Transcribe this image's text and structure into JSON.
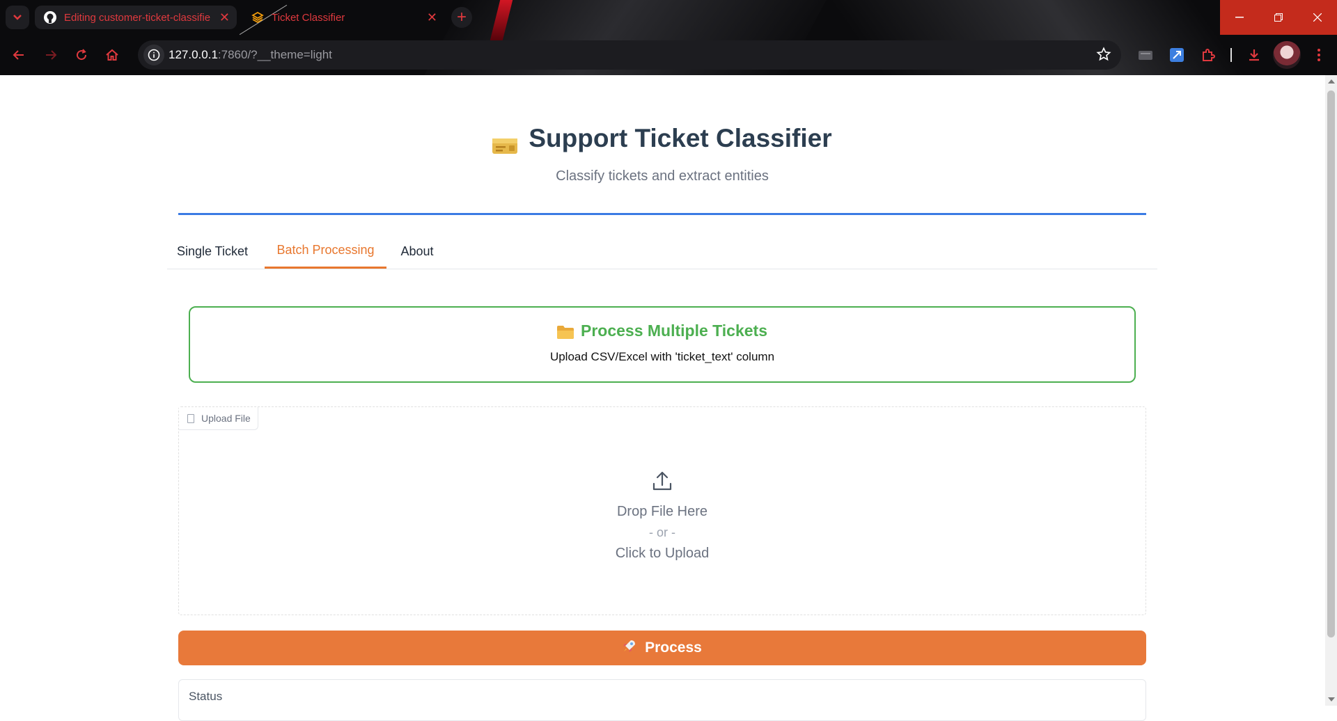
{
  "browser": {
    "tabs": [
      {
        "title": "Editing customer-ticket-classifier",
        "icon": "github-icon"
      },
      {
        "title": "Ticket Classifier",
        "icon": "gradio-icon"
      }
    ],
    "new_tab_symbol": "+",
    "close_symbol": "✕",
    "address": {
      "host": "127.0.0.1",
      "rest": ":7860/?__theme=light"
    },
    "accent_color": "#e0393e"
  },
  "header": {
    "title": "Support Ticket Classifier",
    "subtitle": "Classify tickets and extract entities"
  },
  "tabs": [
    {
      "label": "Single Ticket",
      "active": false
    },
    {
      "label": "Batch Processing",
      "active": true
    },
    {
      "label": "About",
      "active": false
    }
  ],
  "batch": {
    "info_title": "Process Multiple Tickets",
    "info_text": "Upload CSV/Excel with 'ticket_text' column",
    "upload_label": "Upload File",
    "drop_text": "Drop File Here",
    "or_text": "- or -",
    "click_text": "Click to Upload",
    "process_button": "Process",
    "status_label": "Status"
  },
  "colors": {
    "brand_orange": "#e8793a",
    "success_green": "#4caf50",
    "rule_blue": "#3b7be4",
    "title_dark": "#2c3e50"
  }
}
